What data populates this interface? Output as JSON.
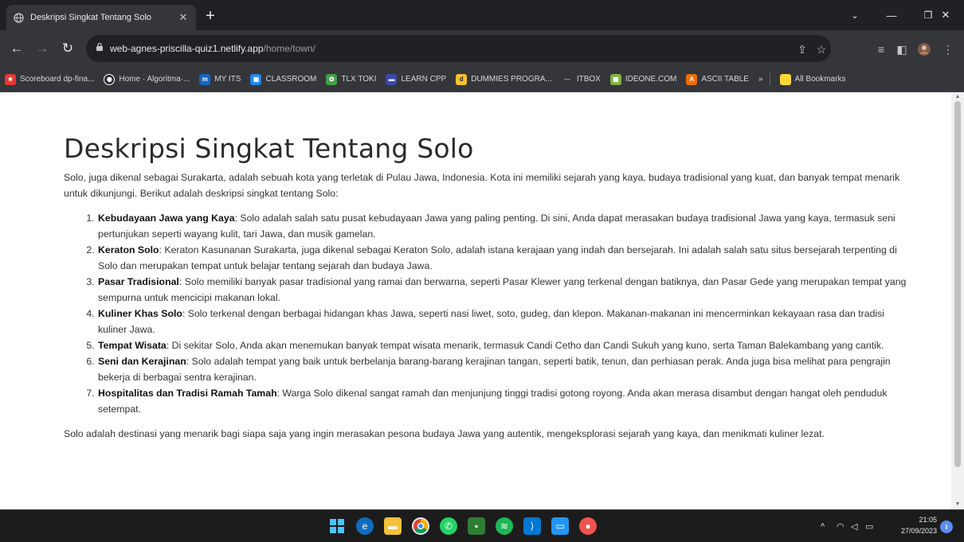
{
  "browser": {
    "tab_title": "Deskripsi Singkat Tentang Solo",
    "url_host": "web-agnes-priscilla-quiz1.netlify.app",
    "url_path": "/home/town/",
    "bookmarks": [
      {
        "label": "Scoreboard dp-fina...",
        "color": "#e53935"
      },
      {
        "label": "Home · Algoritma·...",
        "color": "#ffffff"
      },
      {
        "label": "MY ITS",
        "color": "#1565c0"
      },
      {
        "label": "CLASSROOM",
        "color": "#1e88e5"
      },
      {
        "label": "TLX TOKI",
        "color": "#43a047"
      },
      {
        "label": "LEARN CPP",
        "color": "#3949ab"
      },
      {
        "label": "DUMMIES PROGRA...",
        "color": "#fbc02d"
      },
      {
        "label": "ITBOX",
        "color": "#546e7a"
      },
      {
        "label": "IDEONE.COM",
        "color": "#7cb342"
      },
      {
        "label": "ASCII TABLE",
        "color": "#ef6c00"
      },
      {
        "label": "All Bookmarks",
        "color": "#fdd835"
      }
    ]
  },
  "page": {
    "heading": "Deskripsi Singkat Tentang Solo",
    "intro": "Solo, juga dikenal sebagai Surakarta, adalah sebuah kota yang terletak di Pulau Jawa, Indonesia. Kota ini memiliki sejarah yang kaya, budaya tradisional yang kuat, dan banyak tempat menarik untuk dikunjungi. Berikut adalah deskripsi singkat tentang Solo:",
    "items": [
      {
        "title": "Kebudayaan Jawa yang Kaya",
        "text": ": Solo adalah salah satu pusat kebudayaan Jawa yang paling penting. Di sini, Anda dapat merasakan budaya tradisional Jawa yang kaya, termasuk seni pertunjukan seperti wayang kulit, tari Jawa, dan musik gamelan."
      },
      {
        "title": "Keraton Solo",
        "text": ": Keraton Kasunanan Surakarta, juga dikenal sebagai Keraton Solo, adalah istana kerajaan yang indah dan bersejarah. Ini adalah salah satu situs bersejarah terpenting di Solo dan merupakan tempat untuk belajar tentang sejarah dan budaya Jawa."
      },
      {
        "title": "Pasar Tradisional",
        "text": ": Solo memiliki banyak pasar tradisional yang ramai dan berwarna, seperti Pasar Klewer yang terkenal dengan batiknya, dan Pasar Gede yang merupakan tempat yang sempurna untuk mencicipi makanan lokal."
      },
      {
        "title": "Kuliner Khas Solo",
        "text": ": Solo terkenal dengan berbagai hidangan khas Jawa, seperti nasi liwet, soto, gudeg, dan klepon. Makanan-makanan ini mencerminkan kekayaan rasa dan tradisi kuliner Jawa."
      },
      {
        "title": "Tempat Wisata",
        "text": ": Di sekitar Solo, Anda akan menemukan banyak tempat wisata menarik, termasuk Candi Cetho dan Candi Sukuh yang kuno, serta Taman Balekambang yang cantik."
      },
      {
        "title": "Seni dan Kerajinan",
        "text": ": Solo adalah tempat yang baik untuk berbelanja barang-barang kerajinan tangan, seperti batik, tenun, dan perhiasan perak. Anda juga bisa melihat para pengrajin bekerja di berbagai sentra kerajinan."
      },
      {
        "title": "Hospitalitas dan Tradisi Ramah Tamah",
        "text": ": Warga Solo dikenal sangat ramah dan menjunjung tinggi tradisi gotong royong. Anda akan merasa disambut dengan hangat oleh penduduk setempat."
      }
    ],
    "outro": "Solo adalah destinasi yang menarik bagi siapa saja yang ingin merasakan pesona budaya Jawa yang autentik, mengeksplorasi sejarah yang kaya, dan menikmati kuliner lezat."
  },
  "taskbar": {
    "time": "21:05",
    "date": "27/09/2023"
  }
}
